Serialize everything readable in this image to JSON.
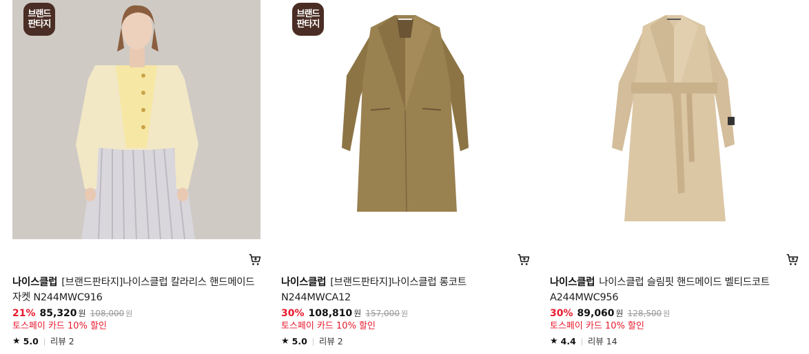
{
  "products": [
    {
      "badge": "브랜드 판타지",
      "brand": "나이스클럽",
      "name": "[브랜드판타지]나이스클럽 칼라리스 핸드메이드 자켓 N244MWC916",
      "discount": "21%",
      "price": "85,320",
      "currency": "원",
      "original_price": "108,000",
      "original_currency": "원",
      "promo": "토스페이 카드 10% 할인",
      "rating": "5.0",
      "reviews": "리뷰 2"
    },
    {
      "badge": "브랜드 판타지",
      "brand": "나이스클럽",
      "name": "[브랜드판타지]나이스클럽 롱코트 N244MWCA12",
      "discount": "30%",
      "price": "108,810",
      "currency": "원",
      "original_price": "157,000",
      "original_currency": "원",
      "promo": "토스페이 카드 10% 할인",
      "rating": "5.0",
      "reviews": "리뷰 2"
    },
    {
      "brand": "나이스클럽",
      "name": "나이스클럽 슬림핏 핸드메이드 벨티드코트 A244MWC956",
      "discount": "30%",
      "price": "89,060",
      "currency": "원",
      "original_price": "128,500",
      "original_currency": "원",
      "promo": "토스페이 카드 10% 할인",
      "rating": "4.4",
      "reviews": "리뷰 14"
    }
  ],
  "icons": {
    "cart": "cart-icon",
    "star": "star-icon"
  },
  "colors": {
    "discount": "#e8192c",
    "badge": "#4a2d24"
  }
}
